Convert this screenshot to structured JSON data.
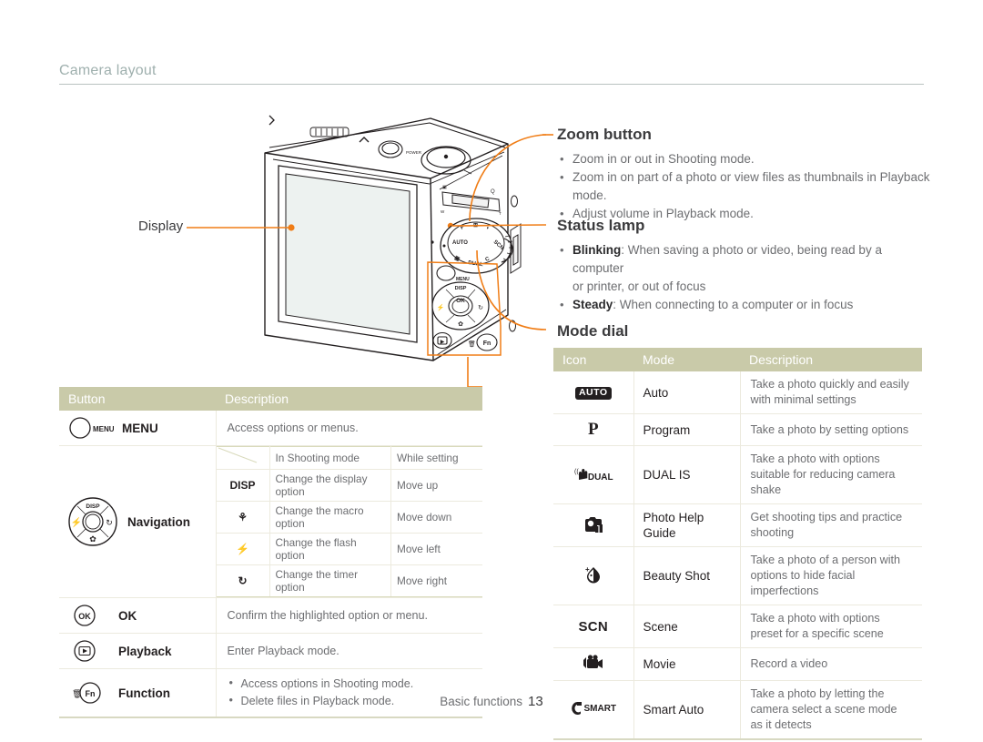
{
  "header": {
    "title": "Camera layout"
  },
  "callouts": {
    "display_label": "Display",
    "zoom": {
      "title": "Zoom button",
      "bullets": [
        "Zoom in or out in Shooting mode.",
        "Zoom in on part of a photo or view files as thumbnails in Playback mode.",
        "Adjust volume in Playback mode."
      ]
    },
    "status": {
      "title": "Status lamp",
      "bullets": [
        {
          "term": "Blinking",
          "sep": ": ",
          "text": "When saving a photo or video, being read by a computer"
        },
        {
          "cont": "or printer, or out of focus"
        },
        {
          "term": "Steady",
          "sep": ": ",
          "text": "When connecting to a computer or in focus"
        }
      ]
    },
    "mode_dial": {
      "title": "Mode dial"
    }
  },
  "button_table": {
    "headers": {
      "button": "Button",
      "description": "Description"
    },
    "rows": [
      {
        "icon": "menu-button-icon",
        "label": "MENU",
        "description": "Access options or menus."
      },
      {
        "icon": "navigation-pad-icon",
        "label": "Navigation",
        "subtable": {
          "headers": {
            "blank": "",
            "shooting": "In Shooting mode",
            "setting": "While setting"
          },
          "rows": [
            {
              "key": "DISP",
              "key_icon": "disp-icon",
              "shooting": "Change the display option",
              "setting": "Move up"
            },
            {
              "key": "⚘",
              "key_icon": "macro-icon",
              "shooting": "Change the macro option",
              "setting": "Move down"
            },
            {
              "key": "⚡",
              "key_icon": "flash-icon",
              "shooting": "Change the flash option",
              "setting": "Move left"
            },
            {
              "key": "↻",
              "key_icon": "timer-icon",
              "shooting": "Change the timer option",
              "setting": "Move right"
            }
          ]
        }
      },
      {
        "icon": "ok-button-icon",
        "label": "OK",
        "description": "Confirm the highlighted option or menu."
      },
      {
        "icon": "playback-button-icon",
        "label": "Playback",
        "description": "Enter Playback mode."
      },
      {
        "icon": "function-button-icon",
        "label": "Function",
        "bullets": [
          "Access options in Shooting mode.",
          "Delete files in Playback mode."
        ]
      }
    ]
  },
  "mode_table": {
    "headers": {
      "icon": "Icon",
      "mode": "Mode",
      "description": "Description"
    },
    "rows": [
      {
        "icon_name": "auto-mode-icon",
        "icon_text": "AUTO",
        "mode": "Auto",
        "description": "Take a photo quickly and easily with minimal settings"
      },
      {
        "icon_name": "program-mode-icon",
        "icon_text": "P",
        "mode": "Program",
        "description": "Take a photo by setting options"
      },
      {
        "icon_name": "dual-is-mode-icon",
        "icon_text": "DUAL",
        "mode": "DUAL IS",
        "description": "Take a photo with options suitable for reducing camera shake"
      },
      {
        "icon_name": "photo-help-guide-mode-icon",
        "icon_text": "",
        "mode": "Photo Help Guide",
        "description": "Get shooting tips and practice shooting"
      },
      {
        "icon_name": "beauty-shot-mode-icon",
        "icon_text": "",
        "mode": "Beauty Shot",
        "description": "Take a photo of a person with options to hide facial imperfections"
      },
      {
        "icon_name": "scene-mode-icon",
        "icon_text": "SCN",
        "mode": "Scene",
        "description": "Take a photo with options preset for a specific scene"
      },
      {
        "icon_name": "movie-mode-icon",
        "icon_text": "",
        "mode": "Movie",
        "description": "Record a video"
      },
      {
        "icon_name": "smart-auto-mode-icon",
        "icon_text": "SMART",
        "mode": "Smart Auto",
        "description": "Take a photo by letting the camera select a scene mode as it detects"
      }
    ]
  },
  "footer": {
    "section": "Basic functions",
    "page": "13"
  },
  "colors": {
    "accent": "#f07d16",
    "table_header_bg": "#c9caa9",
    "heading": "#3b3b3d",
    "body_text": "#6d6e71",
    "rule": "#b9c2c0",
    "header_title": "#9fb0ae"
  }
}
